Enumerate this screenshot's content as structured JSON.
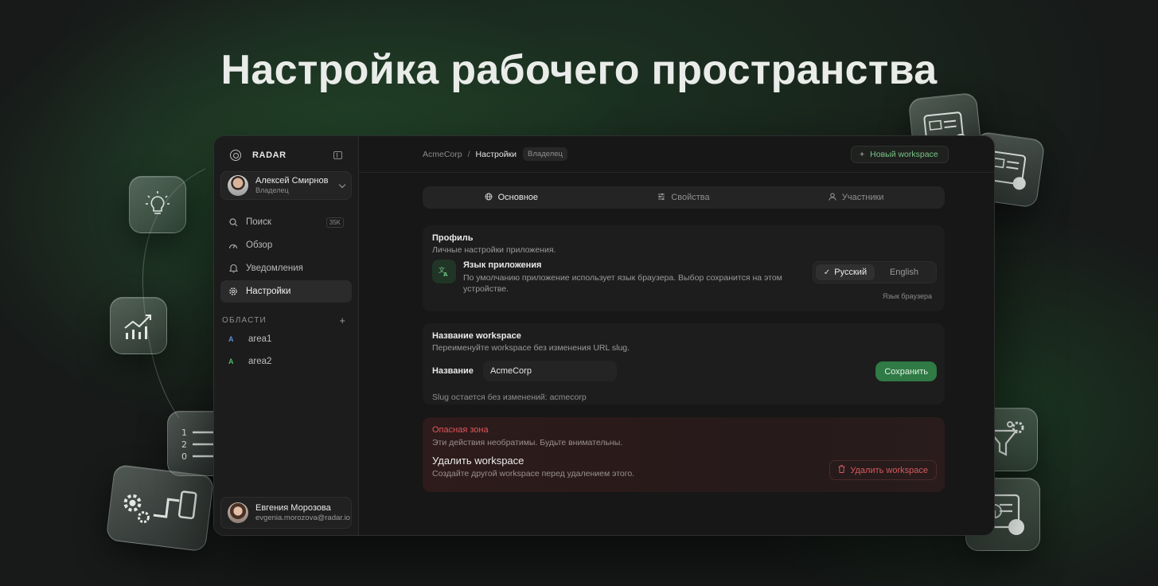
{
  "hero": {
    "title": "Настройка рабочего пространства"
  },
  "sidebar": {
    "brand": "RADAR",
    "user": {
      "name": "Алексей Смирнов",
      "role": "Владелец"
    },
    "nav": [
      {
        "label": "Поиск",
        "icon": "search-icon",
        "shortcut": "35K"
      },
      {
        "label": "Обзор",
        "icon": "gauge-icon"
      },
      {
        "label": "Уведомления",
        "icon": "bell-icon"
      },
      {
        "label": "Настройки",
        "icon": "gear-icon",
        "active": true
      }
    ],
    "areas_heading": "ОБЛАСТИ",
    "areas": [
      {
        "badge": "A",
        "label": "area1",
        "color": "#5b8fd6"
      },
      {
        "badge": "A",
        "label": "area2",
        "color": "#4fb56a"
      }
    ],
    "footer_user": {
      "name": "Евгения Морозова",
      "email": "evgenia.morozova@radar.io"
    }
  },
  "topbar": {
    "crumb_root": "AcmeCorp",
    "crumb_sep": "/",
    "crumb_current": "Настройки",
    "role_badge": "Владелец",
    "new_button": "Новый workspace"
  },
  "tabs": [
    {
      "label": "Основное",
      "icon": "globe-icon",
      "active": true
    },
    {
      "label": "Свойства",
      "icon": "sliders-icon"
    },
    {
      "label": "Участники",
      "icon": "user-icon"
    }
  ],
  "profile": {
    "title": "Профиль",
    "subtitle": "Личные настройки приложения.",
    "language": {
      "title": "Язык приложения",
      "description": "По умолчанию приложение использует язык браузера. Выбор сохранится на этом устройстве.",
      "options": [
        "Русский",
        "English"
      ],
      "selected": "Русский",
      "hint": "Язык браузера"
    }
  },
  "workspace_name": {
    "title": "Название workspace",
    "subtitle": "Переименуйте workspace без изменения URL slug.",
    "field_label": "Название",
    "field_value": "AcmeCorp",
    "save_label": "Сохранить",
    "slug_note": "Slug остается без изменений: acmecorp"
  },
  "danger": {
    "title": "Опасная зона",
    "subtitle": "Эти действия необратимы. Будьте внимательны.",
    "delete_title": "Удалить workspace",
    "delete_subtitle": "Создайте другой workspace перед удалением этого.",
    "delete_button": "Удалить workspace"
  },
  "tiles": [
    "lightbulb-icon",
    "chart-icon",
    "numbered-list-icon",
    "workflow-icon",
    "dashboard-card-icon",
    "dashboard-card-icon",
    "filter-gear-icon",
    "report-icon"
  ],
  "colors": {
    "accent": "#2f7a45",
    "accent_text": "#79c488",
    "danger": "#e0565a",
    "background": "#171a19"
  }
}
